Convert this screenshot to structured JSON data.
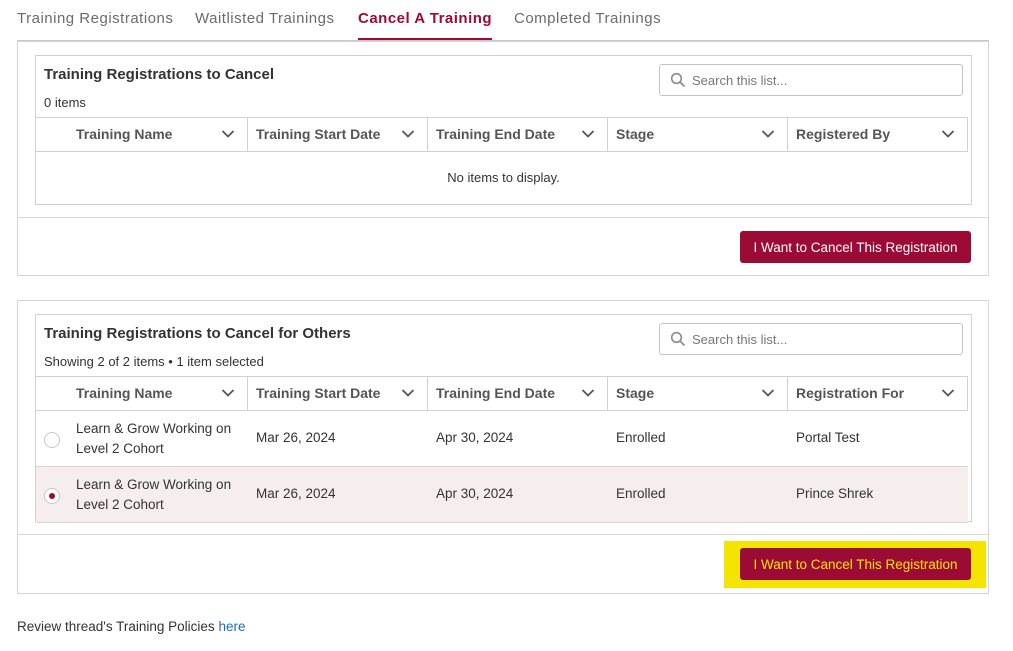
{
  "tabs": [
    {
      "label": "Training Registrations",
      "active": false
    },
    {
      "label": "Waitlisted Trainings",
      "active": false
    },
    {
      "label": "Cancel A Training",
      "active": true
    },
    {
      "label": "Completed Trainings",
      "active": false
    }
  ],
  "colors": {
    "accent": "#9c0b35",
    "highlight": "#f3e500",
    "link": "#1a6fb3",
    "selected_row": "#f6eeee"
  },
  "section1": {
    "title": "Training Registrations to Cancel",
    "count": "0 items",
    "search_placeholder": "Search this list...",
    "columns": [
      "Training Name",
      "Training Start Date",
      "Training End Date",
      "Stage",
      "Registered By"
    ],
    "empty_text": "No items to display.",
    "button_label": "I Want to Cancel This Registration"
  },
  "section2": {
    "title": "Training Registrations to Cancel for Others",
    "count": "Showing 2 of 2 items • 1 item selected",
    "search_placeholder": "Search this list...",
    "columns": [
      "Training Name",
      "Training Start Date",
      "Training End Date",
      "Stage",
      "Registration For"
    ],
    "rows": [
      {
        "selected": false,
        "name": "Learn & Grow Working on Level 2 Cohort",
        "start": "Mar 26, 2024",
        "end": "Apr 30, 2024",
        "stage": "Enrolled",
        "for": "Portal Test"
      },
      {
        "selected": true,
        "name": "Learn & Grow Working on Level 2 Cohort",
        "start": "Mar 26, 2024",
        "end": "Apr 30, 2024",
        "stage": "Enrolled",
        "for": "Prince Shrek"
      }
    ],
    "button_label": "I Want to Cancel This Registration"
  },
  "footer": {
    "text": "Review thread's Training Policies",
    "link_text": "here"
  }
}
